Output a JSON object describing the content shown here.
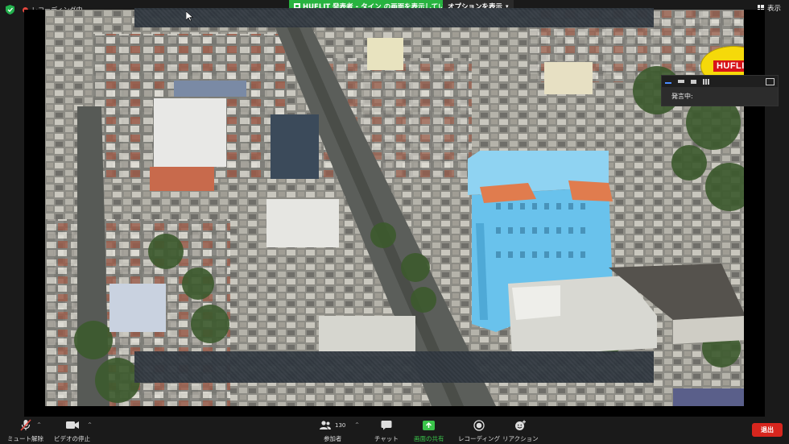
{
  "topbar": {
    "recording_label": "レコーディング中",
    "share_banner": "HUFLIT 発表者 - タイン の画面を表示しています",
    "options_label": "オプションを表示",
    "view_label": "表示"
  },
  "video": {
    "logo_text": "HUFLIT"
  },
  "speaker_panel": {
    "speaking_label": "発言中:"
  },
  "toolbar": {
    "mute_label": "ミュート解除",
    "video_label": "ビデオの停止",
    "participants_label": "参加者",
    "participants_count": "130",
    "chat_label": "チャット",
    "share_label": "画面の共有",
    "record_label": "レコーディング",
    "reaction_label": "リアクション",
    "leave_label": "退出"
  },
  "colors": {
    "share_green": "#27b33f",
    "leave_red": "#d7261e",
    "recording_red": "#e4473e"
  },
  "icons": [
    "shield-icon",
    "record-dot-icon",
    "share-screen-icon",
    "chevron-down-icon",
    "gallery-view-icon",
    "mic-muted-icon",
    "video-camera-icon",
    "participants-icon",
    "chat-bubble-icon",
    "share-arrow-icon",
    "record-icon",
    "reaction-icon"
  ]
}
